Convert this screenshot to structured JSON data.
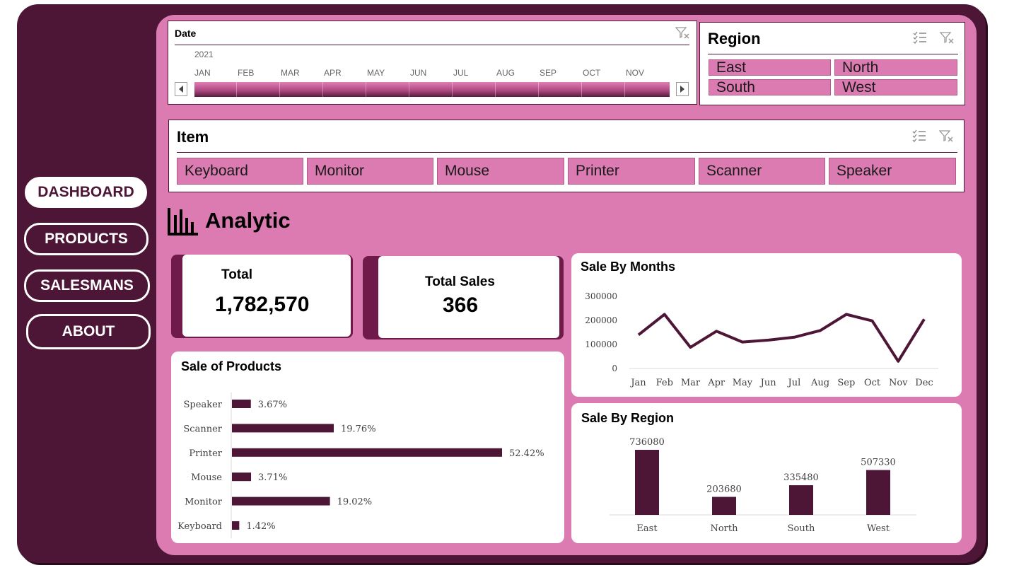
{
  "nav": {
    "dashboard": "DASHBOARD",
    "products": "PRODUCTS",
    "salesmans": "SALESMANS",
    "about": "ABOUT"
  },
  "date_slicer": {
    "title": "Date",
    "year": "2021",
    "months": [
      "JAN",
      "FEB",
      "MAR",
      "APR",
      "MAY",
      "JUN",
      "JUL",
      "AUG",
      "SEP",
      "OCT",
      "NOV"
    ]
  },
  "region_slicer": {
    "title": "Region",
    "items": [
      "East",
      "North",
      "South",
      "West"
    ]
  },
  "item_slicer": {
    "title": "Item",
    "items": [
      "Keyboard",
      "Monitor",
      "Mouse",
      "Printer",
      "Scanner",
      "Speaker"
    ]
  },
  "section": {
    "title": "Analytic"
  },
  "kpi": {
    "total_label": "Total",
    "total_value": "1,782,570",
    "sales_label": "Total Sales",
    "sales_value": "366"
  },
  "colors": {
    "accent": "#4e1636",
    "panel": "#db7bb1",
    "bar": "#4e1636"
  },
  "chart_data": [
    {
      "title": "Sale By Months",
      "type": "line",
      "categories": [
        "Jan",
        "Feb",
        "Mar",
        "Apr",
        "May",
        "Jun",
        "Jul",
        "Aug",
        "Sep",
        "Oct",
        "Nov",
        "Dec"
      ],
      "values": [
        140000,
        225000,
        88000,
        155000,
        110000,
        118000,
        130000,
        158000,
        225000,
        198000,
        30000,
        205000
      ],
      "yticks": [
        "0",
        "100000",
        "200000",
        "300000"
      ],
      "ylim": [
        0,
        300000
      ]
    },
    {
      "title": "Sale of Products",
      "type": "bar",
      "orientation": "horizontal",
      "categories": [
        "Speaker",
        "Scanner",
        "Printer",
        "Mouse",
        "Monitor",
        "Keyboard"
      ],
      "values": [
        3.67,
        19.76,
        52.42,
        3.71,
        19.02,
        1.42
      ],
      "labels": [
        "3.67%",
        "19.76%",
        "52.42%",
        "3.71%",
        "19.02%",
        "1.42%"
      ]
    },
    {
      "title": "Sale By Region",
      "type": "bar",
      "categories": [
        "East",
        "North",
        "South",
        "West"
      ],
      "values": [
        736080,
        203680,
        335480,
        507330
      ],
      "labels": [
        "736080",
        "203680",
        "335480",
        "507330"
      ]
    }
  ]
}
